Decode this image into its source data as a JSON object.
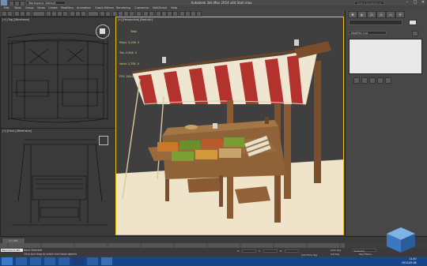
{
  "titlebar": {
    "title": "Autodesk 3ds Max  2014 x64     Stall.max",
    "workspace": "Workspace: Default",
    "search_placeholder": "Type a keyword or phrase",
    "window_controls": [
      "–",
      "□",
      "✕"
    ]
  },
  "menubar": {
    "items": [
      "Edit",
      "Tools",
      "Group",
      "Views",
      "Create",
      "Modifiers",
      "Animation",
      "Graph Editors",
      "Rendering",
      "Customize",
      "MAXScript",
      "Help"
    ]
  },
  "viewports": {
    "top_label": "[+] [Top] [Wireframe]",
    "front_label": "[+] [Front] [Wireframe]",
    "persp_label": "[+] [Perspective] [Realistic]",
    "stats": {
      "header": "Total",
      "polys_label": "Polys:",
      "polys_value": "3,108",
      "polys_sel": "0",
      "tris_label": "Tris:",
      "tris_value": "2,908",
      "tris_sel": "0",
      "verts_label": "Verts:",
      "verts_value": "2,708",
      "verts_sel": "0",
      "fps_label": "FPS:",
      "fps_value": "280.000"
    }
  },
  "command_panel": {
    "modifier_list": "Modifier List"
  },
  "timeline": {
    "frame": "0 / 100"
  },
  "statusbar": {
    "maxscript_label": "Welcome to MA",
    "selection": "None Selected",
    "prompt": "Click and drag to select and move objects",
    "x_label": "X:",
    "y_label": "Y:",
    "z_label": "Z:",
    "add_time_tag": "Add Time Tag",
    "set_key_mode": "Selected",
    "auto_key": "Auto Key",
    "set_key": "Set Key",
    "key_filters": "Key Filters..."
  },
  "taskbar": {
    "time": "11:40",
    "date": "2014-05-08"
  },
  "colors": {
    "active_viewport_border": "#f1c40f",
    "awning_red": "#b3322e",
    "awning_cream": "#efe6d2",
    "wood": "#8a5a32",
    "taskbar": "#16458a"
  }
}
